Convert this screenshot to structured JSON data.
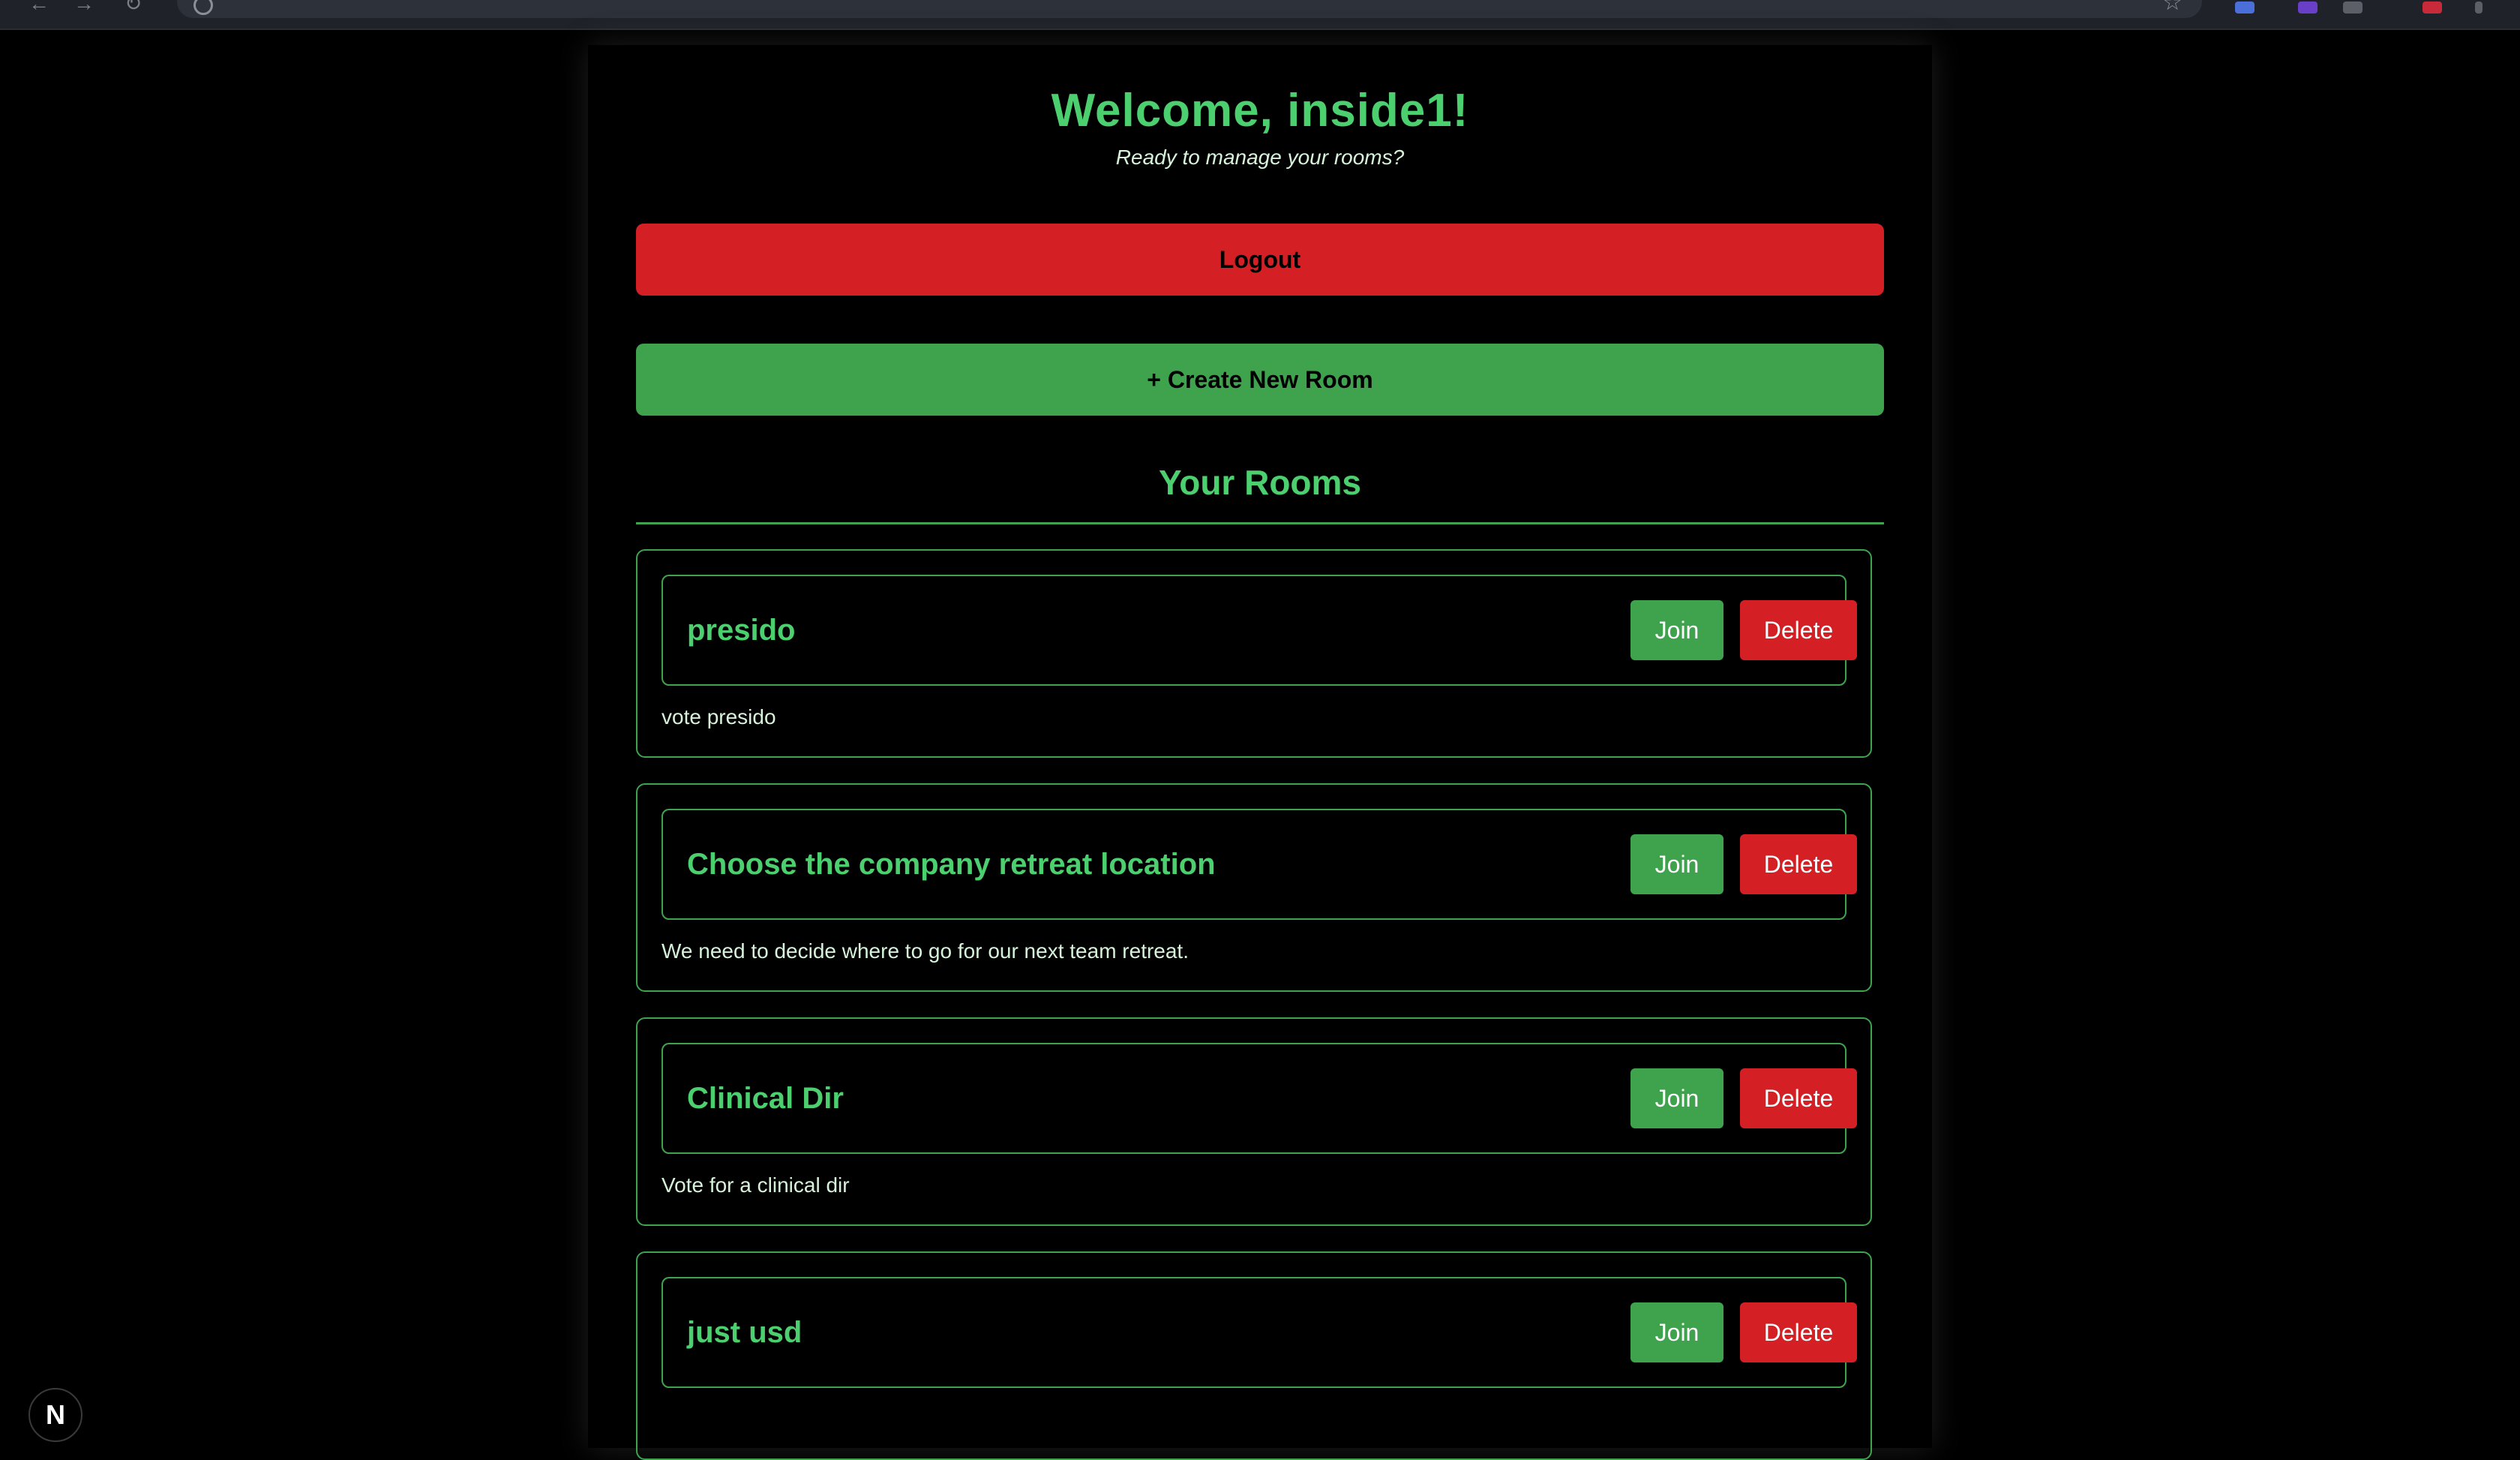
{
  "header": {
    "title": "Welcome, inside1!",
    "subtitle": "Ready to manage your rooms?"
  },
  "actions": {
    "logout_label": "Logout",
    "create_room_label": "+ Create New Room"
  },
  "rooms_section": {
    "heading": "Your Rooms",
    "rooms": [
      {
        "name": "presido",
        "description": "vote presido",
        "join_label": "Join",
        "delete_label": "Delete"
      },
      {
        "name": "Choose the company retreat location",
        "description": "We need to decide where to go for our next team retreat.",
        "join_label": "Join",
        "delete_label": "Delete"
      },
      {
        "name": "Clinical Dir",
        "description": "Vote for a clinical dir",
        "join_label": "Join",
        "delete_label": "Delete"
      },
      {
        "name": "just usd",
        "description": "",
        "join_label": "Join",
        "delete_label": "Delete"
      }
    ]
  },
  "dev_badge": {
    "letter": "N"
  },
  "colors": {
    "accent_green": "#4ccf6e",
    "button_green": "#3fa34d",
    "button_red": "#d42024",
    "background": "#000000"
  },
  "icons": {
    "browser_star": "star-icon",
    "site_info": "site-info-icon",
    "nextjs_badge": "nextjs-logo-icon"
  }
}
